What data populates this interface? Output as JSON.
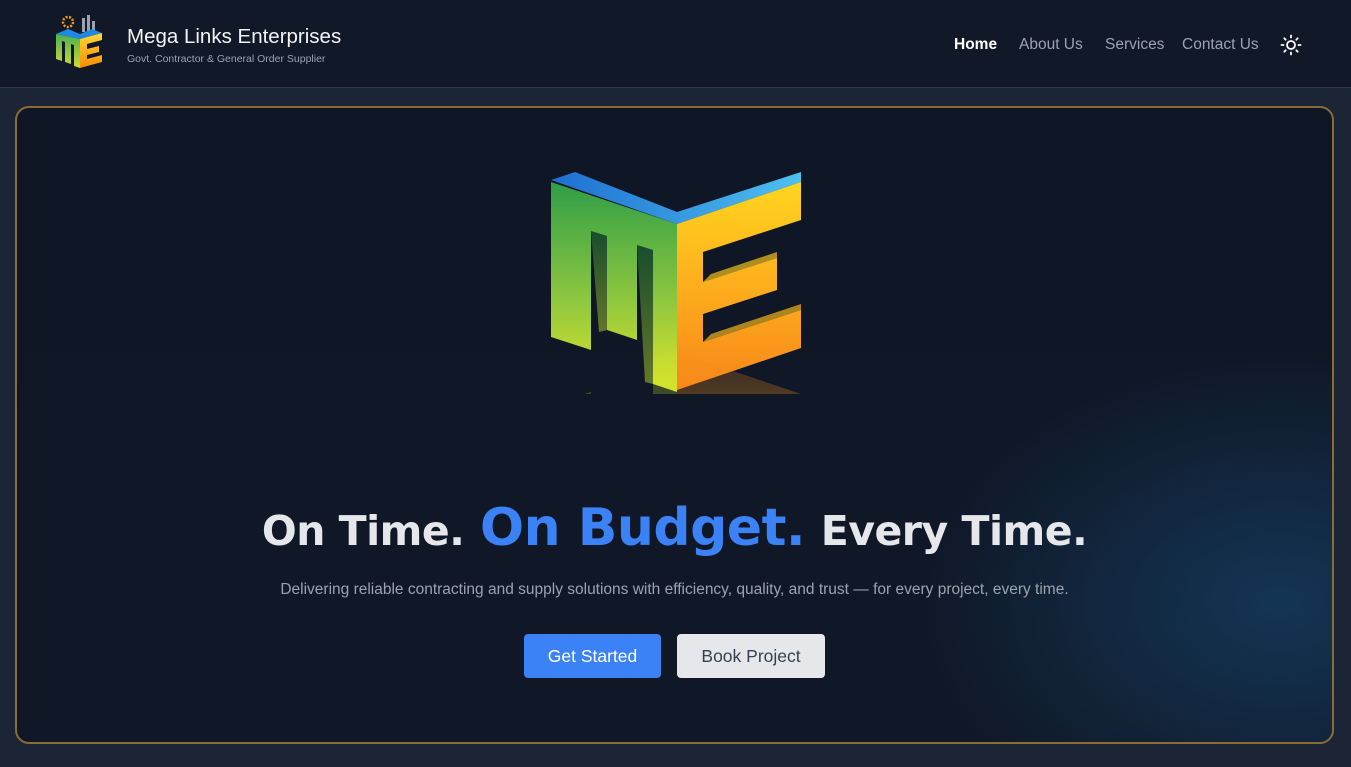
{
  "brand": {
    "name": "Mega Links Enterprises",
    "tagline": "Govt. Contractor & General Order Supplier",
    "logo_icon": "me-logo-icon"
  },
  "nav": {
    "items": [
      {
        "label": "Home",
        "active": true
      },
      {
        "label": "About Us",
        "active": false
      },
      {
        "label": "Services",
        "active": false
      },
      {
        "label": "Contact Us",
        "active": false
      }
    ],
    "theme_toggle_icon": "sun-icon"
  },
  "hero": {
    "logo_icon": "me-3d-logo-icon",
    "headline": {
      "part1": "On Time.",
      "part2": "On Budget.",
      "part3": "Every Time."
    },
    "subtext": "Delivering reliable contracting and supply solutions with efficiency, quality, and trust — for every project, every time.",
    "primary_button": "Get Started",
    "secondary_button": "Book Project"
  },
  "colors": {
    "accent": "#3b82f6",
    "navbar_bg": "#111827",
    "hero_border": "#8a6d32",
    "page_bg": "#1c2536"
  }
}
